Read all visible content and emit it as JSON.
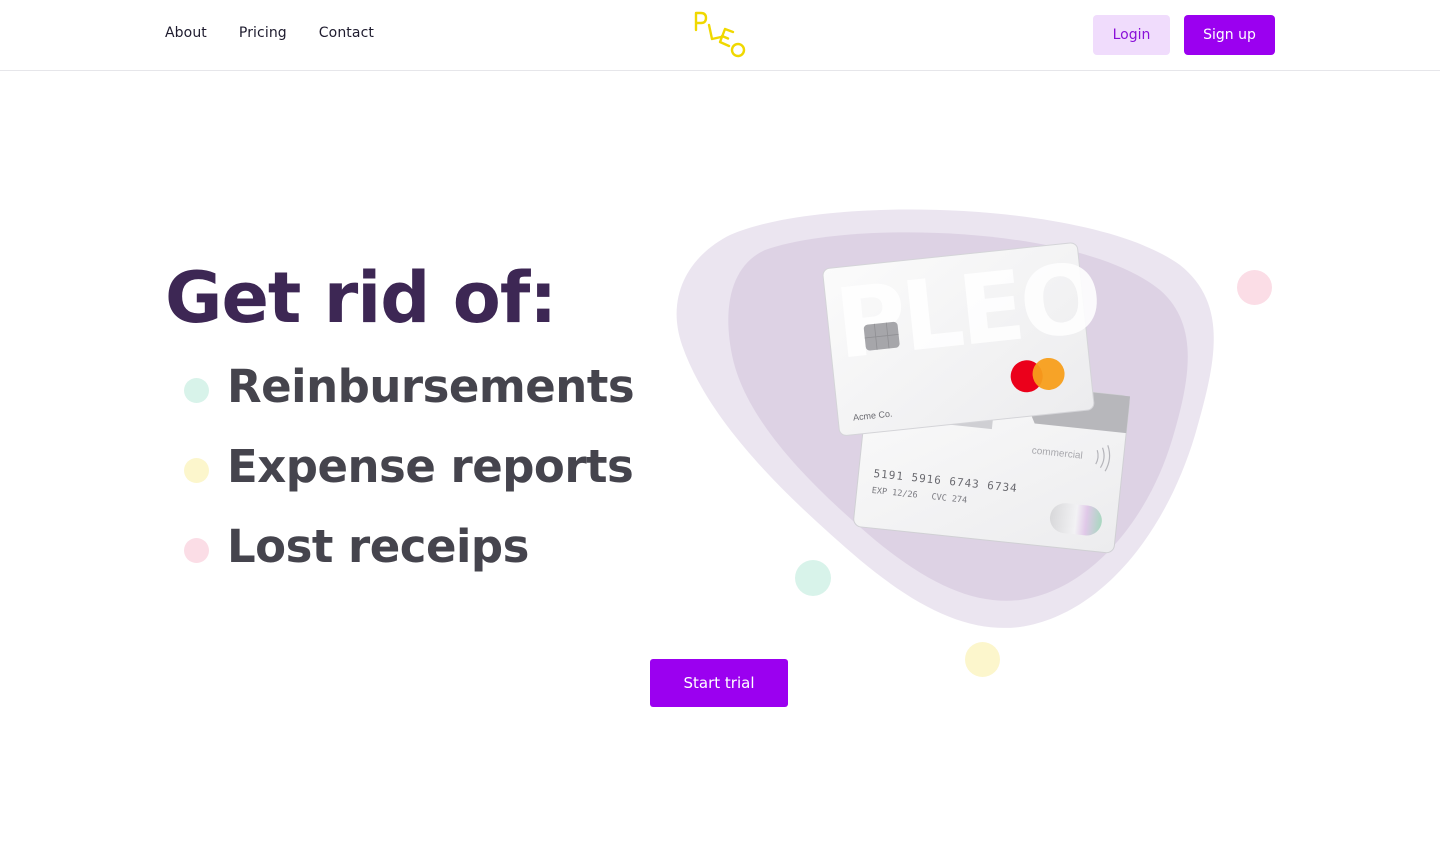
{
  "nav": {
    "items": [
      {
        "label": "About"
      },
      {
        "label": "Pricing"
      },
      {
        "label": "Contact"
      }
    ]
  },
  "brand": {
    "logo_text": "PLEO",
    "color": "#f0d800"
  },
  "auth": {
    "login_label": "Login",
    "signup_label": "Sign up"
  },
  "hero": {
    "headline": "Get rid of:",
    "items": [
      {
        "label": "Reinbursements",
        "dot_color": "#d8f3ea"
      },
      {
        "label": "Expense reports",
        "dot_color": "#fcf6cc"
      },
      {
        "label": "Lost receips",
        "dot_color": "#fbdde6"
      }
    ],
    "cta_label": "Start trial"
  },
  "card": {
    "brand": "PLEO",
    "holder": "Acme Co.",
    "number": "5191 5916 6743 6734",
    "exp": "EXP 12/26",
    "cvc": "CVC 274",
    "type": "commercial"
  },
  "colors": {
    "accent": "#9b00f0",
    "accent_soft": "#f0dcfc",
    "headline": "#3d2754",
    "list_text": "#45444d",
    "blob_outer": "#ebe5f0",
    "blob_inner": "#ddd2e4"
  }
}
